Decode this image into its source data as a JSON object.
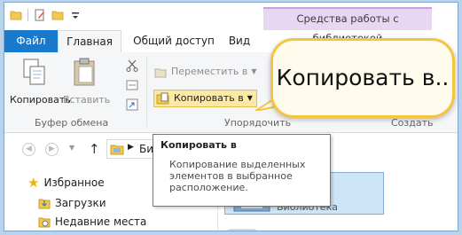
{
  "contextual_header": "Средства работы с библиотекой",
  "tabs": {
    "file": "Файл",
    "home": "Главная",
    "share": "Общий доступ",
    "view": "Вид"
  },
  "ribbon": {
    "copy_label": "Копировать",
    "paste_label": "Вставить",
    "clipboard_group": "Буфер обмена",
    "move_to_label": "Переместить в",
    "copy_to_label": "Копировать в",
    "organize_group": "Упорядочить",
    "create_group": "Создать"
  },
  "callout_text": "Копировать в..",
  "tooltip": {
    "title": "Копировать в",
    "body": "Копирование выделенных элементов в выбранное расположение."
  },
  "address": {
    "crumb": "Би"
  },
  "nav": {
    "favorites": "Избранное",
    "downloads": "Загрузки",
    "recent": "Недавние места"
  },
  "content": {
    "library_label": "Библиотека"
  },
  "colors": {
    "file_tab": "#1979ca",
    "context_tab": "#e7d7f3",
    "callout_border": "#f4c542",
    "copyto_highlight": "#fde9a6"
  }
}
